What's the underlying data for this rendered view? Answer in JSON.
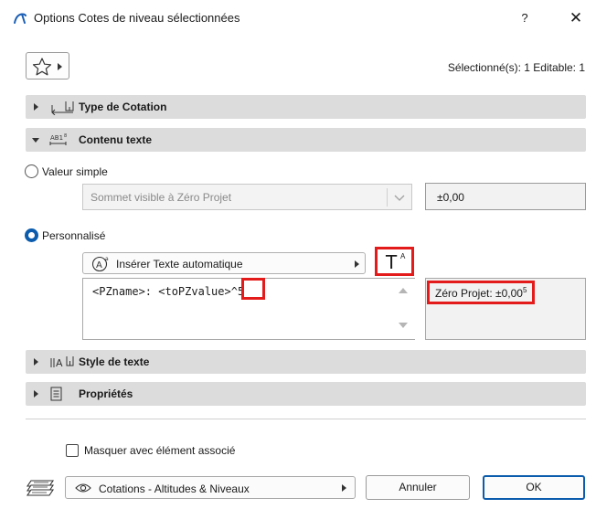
{
  "window": {
    "title": "Options Cotes de niveau sélectionnées",
    "help_label": "?",
    "close_label": "✕"
  },
  "toolbar": {
    "selected_info": "Sélectionné(s): 1 Editable: 1"
  },
  "panels": {
    "type_cotation": "Type de Cotation",
    "contenu_texte": "Contenu texte",
    "style_texte": "Style de texte",
    "proprietes": "Propriétés"
  },
  "contenu": {
    "valeur_simple_label": "Valeur simple",
    "valeur_simple_select": "Sommet visible à Zéro Projet",
    "valeur_simple_value": "±0,00",
    "personnalise_label": "Personnalisé",
    "insert_auto_text_label": "Insérer Texte automatique",
    "format_button_label": "T",
    "format_button_sup": "A",
    "custom_text_value": "<PZname>: <toPZvalue>^5",
    "preview_text": "Zéro Projet: ±0,00",
    "preview_sup": "5"
  },
  "footer": {
    "hide_with_element_label": "Masquer avec élément associé",
    "layer_label": "Cotations - Altitudes & Niveaux",
    "cancel_label": "Annuler",
    "ok_label": "OK"
  },
  "colors": {
    "accent": "#0b5cad",
    "highlight": "#e41b1b",
    "panel_header": "#dcdcdc"
  },
  "state": {
    "valeur_simple_checked": false,
    "personnalise_checked": true,
    "hide_with_element_checked": false,
    "contenu_texte_expanded": true
  }
}
